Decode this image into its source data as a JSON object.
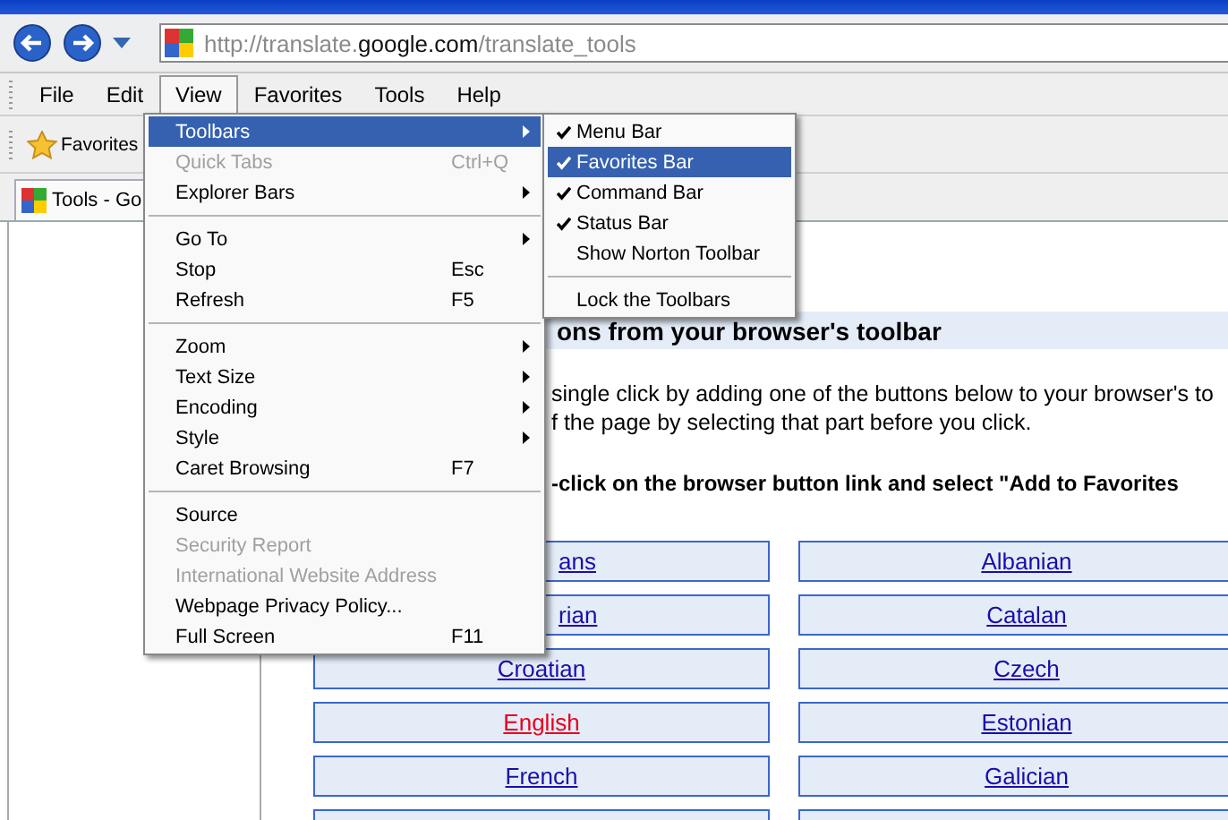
{
  "address_bar": {
    "url_prefix": "http://translate.",
    "url_domain": "google.com",
    "url_suffix": "/translate_tools"
  },
  "menu_bar": [
    {
      "label": "File",
      "selected": false
    },
    {
      "label": "Edit",
      "selected": false
    },
    {
      "label": "View",
      "selected": true
    },
    {
      "label": "Favorites",
      "selected": false
    },
    {
      "label": "Tools",
      "selected": false
    },
    {
      "label": "Help",
      "selected": false
    }
  ],
  "favorites_bar": {
    "label": "Favorites"
  },
  "tab": {
    "label": "Tools - Go"
  },
  "view_menu": [
    {
      "kind": "item",
      "label": "Toolbars",
      "submenu": true,
      "disabled": false,
      "selected": true
    },
    {
      "kind": "item",
      "label": "Quick Tabs",
      "shortcut": "Ctrl+Q",
      "submenu": false,
      "disabled": true,
      "selected": false
    },
    {
      "kind": "item",
      "label": "Explorer Bars",
      "submenu": true,
      "disabled": false,
      "selected": false
    },
    {
      "kind": "separator"
    },
    {
      "kind": "item",
      "label": "Go To",
      "submenu": true,
      "disabled": false,
      "selected": false
    },
    {
      "kind": "item",
      "label": "Stop",
      "shortcut": "Esc",
      "submenu": false,
      "disabled": false,
      "selected": false
    },
    {
      "kind": "item",
      "label": "Refresh",
      "shortcut": "F5",
      "submenu": false,
      "disabled": false,
      "selected": false
    },
    {
      "kind": "separator"
    },
    {
      "kind": "item",
      "label": "Zoom",
      "submenu": true,
      "disabled": false,
      "selected": false
    },
    {
      "kind": "item",
      "label": "Text Size",
      "submenu": true,
      "disabled": false,
      "selected": false
    },
    {
      "kind": "item",
      "label": "Encoding",
      "submenu": true,
      "disabled": false,
      "selected": false
    },
    {
      "kind": "item",
      "label": "Style",
      "submenu": true,
      "disabled": false,
      "selected": false
    },
    {
      "kind": "item",
      "label": "Caret Browsing",
      "shortcut": "F7",
      "submenu": false,
      "disabled": false,
      "selected": false
    },
    {
      "kind": "separator"
    },
    {
      "kind": "item",
      "label": "Source",
      "submenu": false,
      "disabled": false,
      "selected": false
    },
    {
      "kind": "item",
      "label": "Security Report",
      "submenu": false,
      "disabled": true,
      "selected": false
    },
    {
      "kind": "item",
      "label": "International Website Address",
      "submenu": false,
      "disabled": true,
      "selected": false
    },
    {
      "kind": "item",
      "label": "Webpage Privacy Policy...",
      "submenu": false,
      "disabled": false,
      "selected": false
    },
    {
      "kind": "item",
      "label": "Full Screen",
      "shortcut": "F11",
      "submenu": false,
      "disabled": false,
      "selected": false
    }
  ],
  "toolbars_submenu": [
    {
      "kind": "item",
      "label": "Menu Bar",
      "checked": true,
      "selected": false
    },
    {
      "kind": "item",
      "label": "Favorites Bar",
      "checked": true,
      "selected": true
    },
    {
      "kind": "item",
      "label": "Command Bar",
      "checked": true,
      "selected": false
    },
    {
      "kind": "item",
      "label": "Status Bar",
      "checked": true,
      "selected": false
    },
    {
      "kind": "item",
      "label": "Show Norton Toolbar",
      "checked": false,
      "selected": false
    },
    {
      "kind": "separator"
    },
    {
      "kind": "item",
      "label": "Lock the Toolbars",
      "checked": false,
      "selected": false
    }
  ],
  "page": {
    "heading": "ons from your browser's toolbar",
    "paragraph_lines": [
      "single click by adding one of the buttons below to your browser's to",
      "f the page by selecting that part before you click."
    ],
    "instruction": "-click on the browser button link and select \"Add to Favorites",
    "languages": [
      {
        "kind": "partial",
        "label": "ans",
        "selected": false
      },
      {
        "kind": "full",
        "label": "Albanian",
        "selected": false
      },
      {
        "kind": "partial",
        "label": "rian",
        "selected": false
      },
      {
        "kind": "full",
        "label": "Catalan",
        "selected": false
      },
      {
        "kind": "full",
        "label": "Croatian",
        "selected": false
      },
      {
        "kind": "full",
        "label": "Czech",
        "selected": false
      },
      {
        "kind": "full",
        "label": "English",
        "selected": true
      },
      {
        "kind": "full",
        "label": "Estonian",
        "selected": false
      },
      {
        "kind": "full",
        "label": "French",
        "selected": false
      },
      {
        "kind": "full",
        "label": "Galician",
        "selected": false
      }
    ]
  }
}
